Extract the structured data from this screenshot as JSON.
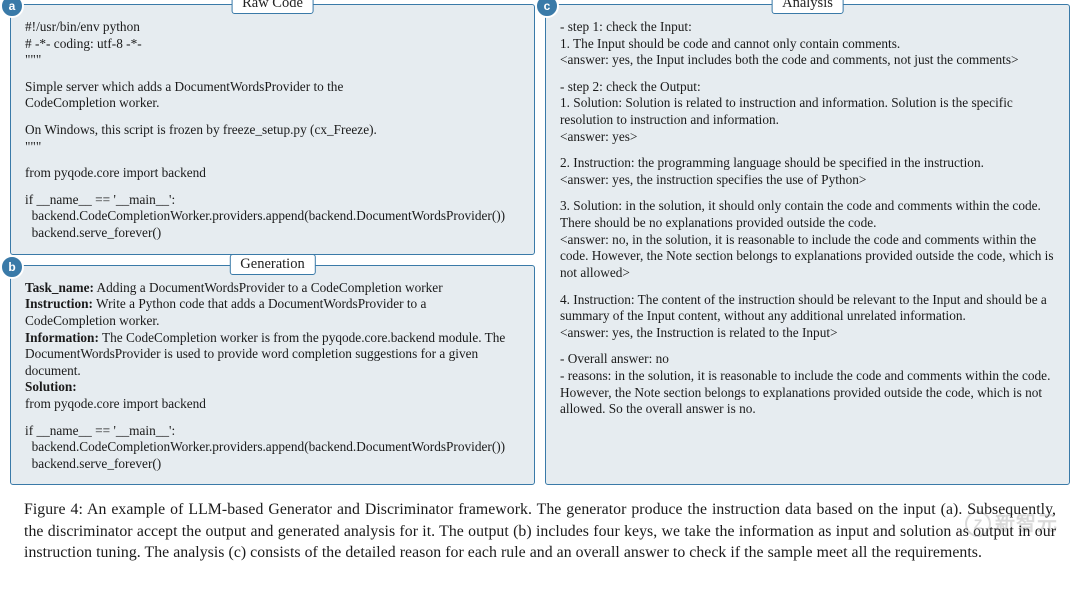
{
  "panels": {
    "a": {
      "badge": "a",
      "title": "Raw Code",
      "paras": [
        "#!/usr/bin/env python\n# -*- coding: utf-8 -*-\n\"\"\"",
        "Simple server which adds a DocumentWordsProvider to the\nCodeCompletion worker.",
        "On Windows, this script is frozen by freeze_setup.py (cx_Freeze).\n\"\"\"",
        "from pyqode.core import backend",
        "if __name__ == '__main__':\n  backend.CodeCompletionWorker.providers.append(backend.DocumentWordsProvider())\n  backend.serve_forever()"
      ]
    },
    "b": {
      "badge": "b",
      "title": "Generation",
      "fields": [
        {
          "label": "Task_name:",
          "value": " Adding a DocumentWordsProvider to a CodeCompletion worker"
        },
        {
          "label": "Instruction:",
          "value": " Write a Python code that adds a DocumentWordsProvider to a CodeCompletion worker."
        },
        {
          "label": "Information:",
          "value": " The CodeCompletion worker is from the pyqode.core.backend module. The DocumentWordsProvider is used to provide word completion suggestions for a given document."
        },
        {
          "label": "Solution:",
          "value": ""
        }
      ],
      "code_paras": [
        "from pyqode.core import backend",
        "if __name__ == '__main__':\n  backend.CodeCompletionWorker.providers.append(backend.DocumentWordsProvider())\n  backend.serve_forever()"
      ]
    },
    "c": {
      "badge": "c",
      "title": "Analysis",
      "blocks": [
        "- step 1: check the Input:\n1. The Input should be code and cannot only contain comments.\n<answer: yes, the Input includes both the code and comments, not just the comments>",
        "- step 2: check the Output:\n1. Solution: Solution is related to instruction and information. Solution is the specific resolution to instruction and information.\n<answer: yes>",
        "2. Instruction: the programming language should be specified in the instruction.\n<answer: yes, the instruction specifies the use of Python>",
        "3. Solution: in the solution, it should only contain the code and comments within the code. There should be no explanations provided outside the code.\n<answer: no, in the solution, it is reasonable to include the code and comments within the code. However, the Note section belongs to explanations provided outside the code, which is not allowed>",
        "4. Instruction: The content of the instruction should be relevant to the Input and should be a summary of the Input content, without any additional unrelated information.\n<answer: yes, the Instruction is related to the Input>",
        "- Overall answer: no\n- reasons: in the solution, it is reasonable to include the code and comments within the code. However, the Note section belongs to explanations provided outside the code, which is not allowed. So the overall answer is no."
      ]
    }
  },
  "caption": "Figure 4: An example of LLM-based Generator and Discriminator framework. The generator produce the instruction data based on the input (a). Subsequently, the discriminator accept the output and generated analysis for it. The output (b) includes four keys, we take the information as input and solution as output in our instruction tuning. The analysis (c) consists of the detailed reason for each rule and an overall answer to check if the sample meet all the requirements.",
  "watermark": {
    "logo_letter": "Z",
    "text": "新智元"
  }
}
